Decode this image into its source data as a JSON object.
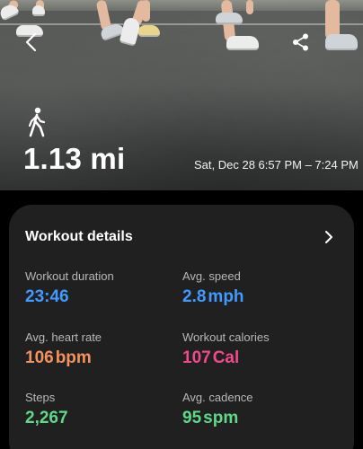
{
  "header": {
    "activity_icon": "walking-icon",
    "back_icon": "back-arrow-icon",
    "share_icon": "share-icon"
  },
  "summary": {
    "distance": "1.13 mi",
    "date_range": "Sat, Dec 28 6:57 PM – 7:24 PM"
  },
  "details": {
    "title": "Workout details",
    "chevron_icon": "chevron-right-icon",
    "metrics": {
      "duration": {
        "label": "Workout duration",
        "value": "23:46",
        "unit": "",
        "color": "#3f9bff"
      },
      "speed": {
        "label": "Avg. speed",
        "value": "2.8",
        "unit": "mph",
        "color": "#3f9bff"
      },
      "heart_rate": {
        "label": "Avg. heart rate",
        "value": "106",
        "unit": "bpm",
        "color": "#f3925d"
      },
      "calories": {
        "label": "Workout calories",
        "value": "107",
        "unit": "Cal",
        "color": "#f0498c"
      },
      "steps": {
        "label": "Steps",
        "value": "2,267",
        "unit": "",
        "color": "#5fd88a"
      },
      "cadence": {
        "label": "Avg. cadence",
        "value": "95",
        "unit": "spm",
        "color": "#5fd88a"
      }
    }
  }
}
